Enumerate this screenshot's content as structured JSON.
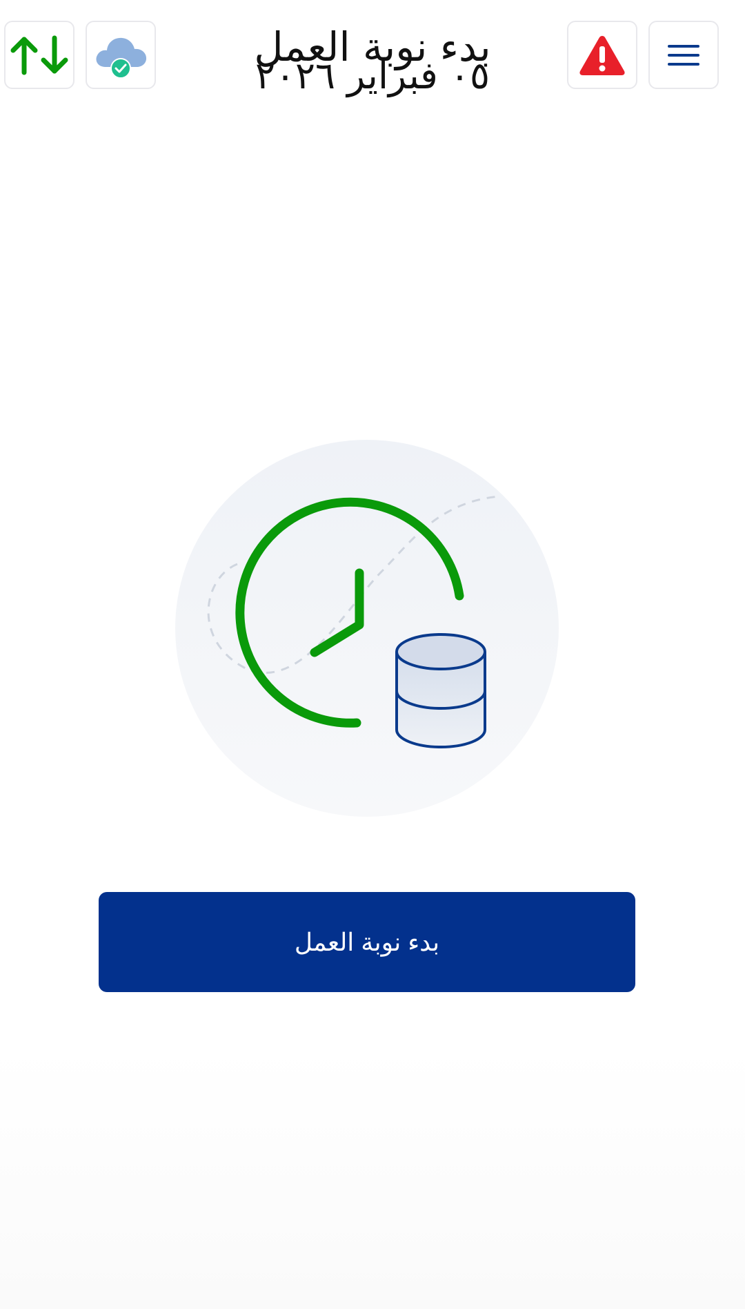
{
  "header": {
    "title": "بدء نوبة العمل",
    "date": "٠٥ فبراير ٢٠٢٦"
  },
  "toolbar": {
    "sync_icon": "sync-arrows-icon",
    "cloud_icon": "cloud-check-icon",
    "alert_icon": "warning-icon",
    "menu_icon": "hamburger-menu-icon"
  },
  "illustration": {
    "icon": "clock-database-icon"
  },
  "main": {
    "start_shift_label": "بدء نوبة العمل"
  },
  "colors": {
    "primary": "#03318d",
    "green": "#0a9a0a",
    "alert_red": "#e8202a",
    "cloud_blue": "#8db0dd",
    "check_teal": "#1fbf8f"
  }
}
